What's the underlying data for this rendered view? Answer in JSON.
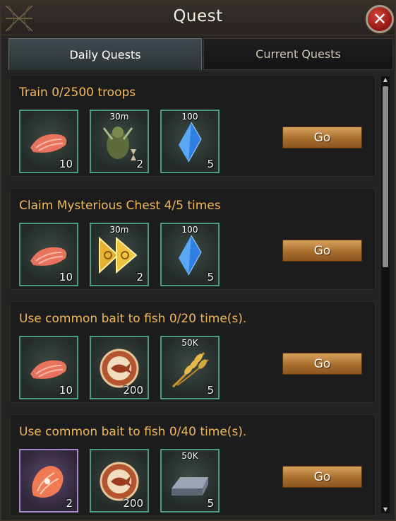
{
  "window": {
    "title": "Quest"
  },
  "tabs": [
    {
      "label": "Daily Quests",
      "active": true
    },
    {
      "label": "Current Quests",
      "active": false
    }
  ],
  "quests": [
    {
      "title": "Train 0/2500 troops",
      "action": "Go",
      "rewards": [
        {
          "icon": "salmon-fillet-icon",
          "qty": "10",
          "label": ""
        },
        {
          "icon": "troop-speedup-icon",
          "qty": "2",
          "label": "30m"
        },
        {
          "icon": "blue-crystal-icon",
          "qty": "5",
          "label": "100"
        }
      ]
    },
    {
      "title": "Claim Mysterious Chest 4/5 times",
      "action": "Go",
      "rewards": [
        {
          "icon": "salmon-fillet-icon",
          "qty": "10",
          "label": ""
        },
        {
          "icon": "gold-speedup-icon",
          "qty": "2",
          "label": "30m"
        },
        {
          "icon": "blue-crystal-icon",
          "qty": "5",
          "label": "100"
        }
      ]
    },
    {
      "title": "Use common bait to fish 0/20 time(s).",
      "action": "Go",
      "rewards": [
        {
          "icon": "salmon-fillet-icon",
          "qty": "10",
          "label": ""
        },
        {
          "icon": "fish-medal-icon",
          "qty": "200",
          "label": ""
        },
        {
          "icon": "wheat-icon",
          "qty": "5",
          "label": "50K"
        }
      ]
    },
    {
      "title": "Use common bait to fish 0/40 time(s).",
      "action": "Go",
      "rewards": [
        {
          "icon": "salmon-steak-icon",
          "qty": "2",
          "label": ""
        },
        {
          "icon": "fish-medal-icon",
          "qty": "200",
          "label": ""
        },
        {
          "icon": "iron-ingot-icon",
          "qty": "5",
          "label": "50K"
        }
      ]
    }
  ]
}
